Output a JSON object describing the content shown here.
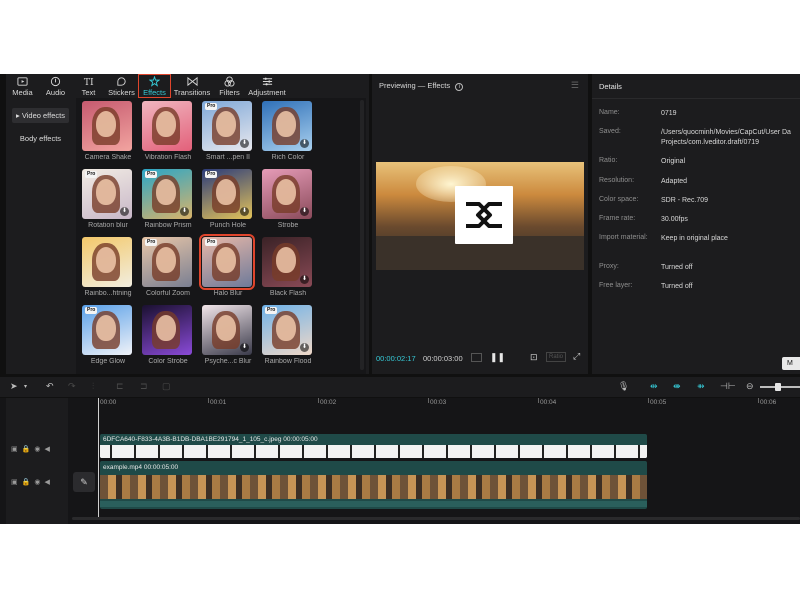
{
  "top_tabs": [
    {
      "label": "Media",
      "icon": "media-icon"
    },
    {
      "label": "Audio",
      "icon": "audio-icon"
    },
    {
      "label": "Text",
      "icon": "text-icon"
    },
    {
      "label": "Stickers",
      "icon": "stickers-icon"
    },
    {
      "label": "Effects",
      "icon": "effects-icon",
      "active": true
    },
    {
      "label": "Transitions",
      "icon": "transitions-icon"
    },
    {
      "label": "Filters",
      "icon": "filters-icon"
    },
    {
      "label": "Adjustment",
      "icon": "adjustment-icon"
    }
  ],
  "sidebar": {
    "items": [
      {
        "label": "▸ Video effects",
        "active": true
      },
      {
        "label": "Body effects",
        "active": false
      }
    ]
  },
  "effects": [
    {
      "label": "Camera Shake",
      "pro": false,
      "download": false,
      "colors": [
        "#c65a6f",
        "#f2a4a0"
      ]
    },
    {
      "label": "Vibration Flash",
      "pro": false,
      "download": false,
      "colors": [
        "#f0b6bf",
        "#e3607a"
      ]
    },
    {
      "label": "Smart ...pen II",
      "pro": true,
      "download": true,
      "colors": [
        "#7fa8d8",
        "#e8e8ee"
      ]
    },
    {
      "label": "Rich Color",
      "pro": false,
      "download": true,
      "colors": [
        "#2f70b8",
        "#a9d0ee"
      ]
    },
    {
      "label": "Rotation blur",
      "pro": true,
      "download": true,
      "colors": [
        "#f2ece4",
        "#c8b7c8"
      ]
    },
    {
      "label": "Rainbow Prism",
      "pro": true,
      "download": true,
      "colors": [
        "#2aa6c7",
        "#d9b36a"
      ]
    },
    {
      "label": "Punch Hole",
      "pro": true,
      "download": true,
      "colors": [
        "#2b3b7a",
        "#e3c35a"
      ]
    },
    {
      "label": "Strobe",
      "pro": false,
      "download": true,
      "colors": [
        "#e69cb8",
        "#8a4a5a"
      ]
    },
    {
      "label": "Rainbo...htning",
      "pro": false,
      "download": false,
      "colors": [
        "#f3c86a",
        "#f2eee0"
      ]
    },
    {
      "label": "Colorful Zoom",
      "pro": true,
      "download": false,
      "colors": [
        "#e8c6a8",
        "#7a7f92"
      ]
    },
    {
      "label": "Halo Blur",
      "pro": true,
      "download": false,
      "colors": [
        "#e8b8a8",
        "#6e7a9a"
      ],
      "selected": true
    },
    {
      "label": "Black Flash",
      "pro": false,
      "download": true,
      "colors": [
        "#3a2226",
        "#8a4a56"
      ]
    },
    {
      "label": "Edge Glow",
      "pro": true,
      "download": false,
      "colors": [
        "#5aa0e8",
        "#f0f2f8"
      ]
    },
    {
      "label": "Color Strobe",
      "pro": false,
      "download": false,
      "colors": [
        "#1a1030",
        "#8a4ad8"
      ]
    },
    {
      "label": "Psyche...c Blur",
      "pro": false,
      "download": true,
      "colors": [
        "#f2e6ea",
        "#3a3a4a"
      ]
    },
    {
      "label": "Rainbow Flood",
      "pro": true,
      "download": true,
      "colors": [
        "#6fb2e8",
        "#f0d8c8"
      ]
    }
  ],
  "player": {
    "title": "Previewing — Effects",
    "current_time": "00:00:02:17",
    "duration": "00:00:03:00",
    "ratio_button": "Ratio"
  },
  "details": {
    "title": "Details",
    "rows": [
      {
        "key": "Name:",
        "value": "0719"
      },
      {
        "key": "Saved:",
        "value": "/Users/quocminh/Movies/CapCut/User Da",
        "value2": "Projects/com.lveditor.draft/0719"
      },
      {
        "key": "Ratio:",
        "value": "Original"
      },
      {
        "key": "Resolution:",
        "value": "Adapted"
      },
      {
        "key": "Color space:",
        "value": "SDR - Rec.709"
      },
      {
        "key": "Frame rate:",
        "value": "30.00fps"
      },
      {
        "key": "Import material:",
        "value": "Keep in original place"
      },
      {
        "key": "Proxy:",
        "value": "Turned off"
      },
      {
        "key": "Free layer:",
        "value": "Turned off"
      }
    ],
    "modify_button": "M"
  },
  "timeline": {
    "ruler_ticks": [
      "00:00",
      "00:01",
      "00:02",
      "00:03",
      "00:04",
      "00:05",
      "00:06"
    ],
    "clip1_label": "6DFCA640-F833-4A3B-B1DB-DBA1BE291794_1_105_c.jpeg  00:00:05:00",
    "clip2_label": "example.mp4  00:00:05:00"
  },
  "colors": {
    "accent": "#36c9d6",
    "selection": "#e0452c",
    "panel": "#1c1c1e",
    "clip": "#1f4a48"
  }
}
